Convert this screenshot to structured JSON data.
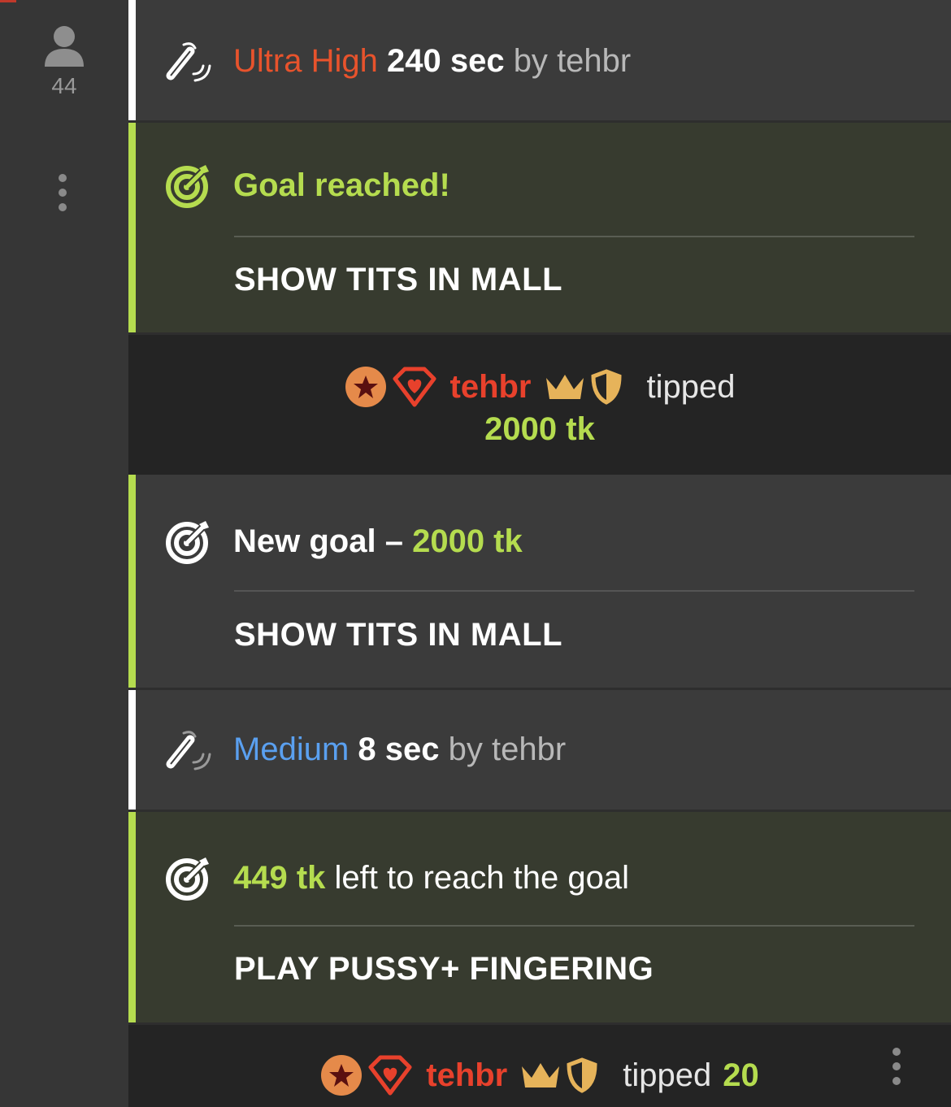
{
  "sidebar": {
    "user_count": "44"
  },
  "messages": {
    "lovense_1": {
      "level": "Ultra High",
      "duration": "240 sec",
      "by": "by",
      "user": "tehbr",
      "level_color": "#e8532c"
    },
    "goal_reached": {
      "headline": "Goal reached!",
      "goal_text": "SHOW TITS IN MALL"
    },
    "tip_1": {
      "user": "tehbr",
      "verb": "tipped",
      "amount": "2000 tk"
    },
    "new_goal": {
      "prefix": "New goal –",
      "amount": "2000 tk",
      "goal_text": "SHOW TITS IN MALL"
    },
    "lovense_2": {
      "level": "Medium",
      "duration": "8 sec",
      "by": "by",
      "user": "tehbr",
      "level_color": "#5aa0f0"
    },
    "goal_progress": {
      "amount": "449 tk",
      "suffix": "left to reach the goal",
      "goal_text": "PLAY PUSSY+ FINGERING"
    },
    "tip_2": {
      "user": "tehbr",
      "verb": "tipped",
      "amount": "20"
    }
  },
  "icons": {
    "user": "user-icon",
    "menu": "more-vertical-icon",
    "lovense": "vibrator-icon",
    "goal": "target-icon",
    "star_badge": "star-badge-icon",
    "diamond_badge": "diamond-heart-icon",
    "crown": "crown-icon",
    "shield": "shield-icon"
  },
  "colors": {
    "accent_green": "#b5dc4f",
    "username_red": "#e8412c",
    "ultra_high_orange": "#e8532c",
    "medium_blue": "#5aa0f0"
  }
}
